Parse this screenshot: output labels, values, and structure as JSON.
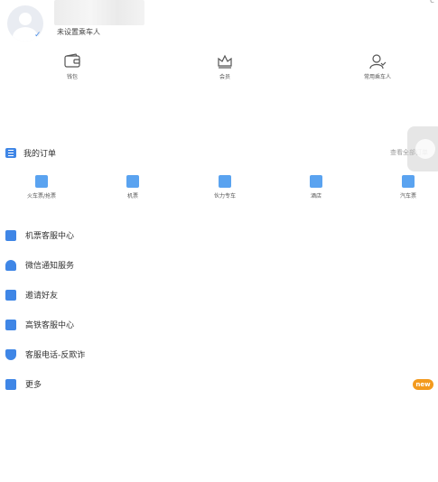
{
  "profile": {
    "passenger_hint": "未设置乘车人",
    "corner_mark": "c"
  },
  "quick_entries": [
    {
      "label": "钱包",
      "icon": "wallet-icon"
    },
    {
      "label": "会员",
      "icon": "crown-icon"
    },
    {
      "label": "常用乘车人",
      "icon": "passenger-icon"
    }
  ],
  "orders": {
    "title": "我的订单",
    "view_all": "查看全部订单",
    "items": [
      {
        "label": "火车票/抢票",
        "icon": "train-icon"
      },
      {
        "label": "机票",
        "icon": "plane-icon"
      },
      {
        "label": "伙力专车",
        "icon": "car-icon"
      },
      {
        "label": "酒店",
        "icon": "hotel-icon"
      },
      {
        "label": "汽车票",
        "icon": "bus-icon"
      }
    ]
  },
  "services": [
    {
      "label": "机票客服中心",
      "icon": "plane-service-icon"
    },
    {
      "label": "微信通知服务",
      "icon": "bell-icon"
    },
    {
      "label": "邀请好友",
      "icon": "gift-icon"
    },
    {
      "label": "高铁客服中心",
      "icon": "train-service-icon"
    },
    {
      "label": "客服电话-反欺诈",
      "icon": "shield-phone-icon"
    },
    {
      "label": "更多",
      "icon": "more-icon"
    }
  ],
  "badge": {
    "new": "new"
  },
  "colors": {
    "accent": "#3f86e6",
    "badge": "#f39a1e"
  }
}
